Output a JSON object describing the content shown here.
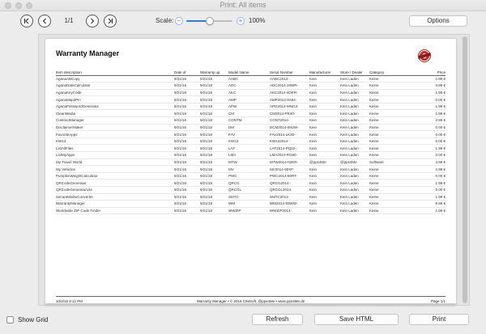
{
  "window": {
    "title": "Print: All items"
  },
  "toolbar": {
    "page_count": "1/1",
    "scale_label": "Scale:",
    "scale_value": "100%",
    "scale_level": 0.5,
    "minus_symbol": "−",
    "plus_symbol": "+",
    "options_label": "Options"
  },
  "document": {
    "title": "Warranty Manager",
    "columns": [
      "Item description",
      "Date of",
      "Warranty up",
      "Model Name",
      "Serial Number",
      "Manufacturer",
      "Store / Dealer",
      "Category",
      "Price"
    ],
    "rows": [
      [
        "AganaABCopy",
        "9/21/16",
        "9/21/18",
        "AABC",
        "AABC2014-",
        "Kein",
        "Kein Laden",
        "Keine",
        "1.99 €"
      ],
      [
        "AganaDateCalculator",
        "9/21/16",
        "9/21/18",
        "ADC",
        "ADC2014-20WR-",
        "Kein",
        "Kein Laden",
        "Keine",
        "0.99 €"
      ],
      [
        "AganaKeyCode",
        "9/21/16",
        "9/21/18",
        "AKC",
        "AKC2014-4OER-",
        "Kein",
        "Kein Laden",
        "Keine",
        "1.99 €"
      ],
      [
        "AganaMap2Pin",
        "9/21/16",
        "9/21/18",
        "AMP",
        "AMP2014-9A84-",
        "Kein",
        "Kein Laden",
        "Keine",
        "0.00 €"
      ],
      [
        "AganaPasswordGenerator",
        "9/21/16",
        "9/21/18",
        "APW",
        "APG2014-MNG3-",
        "Kein",
        "Kein Laden",
        "Keine",
        "1.99 €"
      ],
      [
        "CleanMedia",
        "9/21/16",
        "9/21/18",
        "CM",
        "CM2014-PR40-",
        "Kein",
        "Kein Laden",
        "Keine",
        "1.99 €"
      ],
      [
        "ContractManager",
        "9/21/16",
        "9/21/18",
        "CONTM",
        "CONT2014-",
        "Kein",
        "Kein Laden",
        "Keine",
        "2.99 €"
      ],
      [
        "DisclaimerMaker",
        "9/21/16",
        "9/21/18",
        "DM",
        "DCM2014-09UW-",
        "Kein",
        "Kein Laden",
        "Keine",
        "0.00 €"
      ],
      [
        "FavoriteApps",
        "9/21/16",
        "9/21/18",
        "FAV",
        "FAV2014-LK30-",
        "Kein",
        "Kein Laden",
        "Keine",
        "0.00 €"
      ],
      [
        "KW13",
        "9/21/16",
        "9/21/18",
        "KW13",
        "KW132014-",
        "Kein",
        "Kein Laden",
        "Keine",
        "0.00 €"
      ],
      [
        "ListAllFiles",
        "9/21/16",
        "9/21/18",
        "LAF",
        "LAF2014-PQ02-",
        "Kein",
        "Kein Laden",
        "Keine",
        "1.99 €"
      ],
      [
        "ListMyApps",
        "9/21/16",
        "9/21/18",
        "LMA",
        "LMA2014-RG80-",
        "Kein",
        "Kein Laden",
        "Keine",
        "0.00 €"
      ],
      [
        "My Travel World",
        "9/21/16",
        "9/21/18",
        "MTW",
        "MTW2014-02ER-",
        "@pps4Me",
        "@pps4Me",
        "Software",
        "4.99 €"
      ],
      [
        "My Vehicles",
        "9/21/16",
        "9/21/18",
        "MV",
        "MV2014-90XF-",
        "Kein",
        "Kein Laden",
        "Keine",
        "4.99 €"
      ],
      [
        "PumpkinWeightCalculator",
        "9/21/16",
        "9/21/18",
        "PWC",
        "PWC2014-80RT-",
        "Kein",
        "Kein Laden",
        "Keine",
        "0.00 €"
      ],
      [
        "QRCodeGenerator",
        "9/21/16",
        "9/21/18",
        "QRCG",
        "QRCG2014-",
        "Kein",
        "Kein Laden",
        "Keine",
        "1.99 €"
      ],
      [
        "QRCodeGeneratorLite",
        "9/21/16",
        "9/21/18",
        "QRCGL",
        "QRCGL2014-",
        "Kein",
        "Kein Laden",
        "Keine",
        "0.00 €"
      ],
      [
        "SecureMailtoConverter",
        "9/21/16",
        "9/21/18",
        "SMTC",
        "SMTC2014-",
        "Kein",
        "Kein Laden",
        "Keine",
        "1.99 €"
      ],
      [
        "WarrantyManager",
        "9/21/16",
        "9/21/18",
        "WM",
        "WM2014-93WW-",
        "Kein",
        "Kein Laden",
        "Keine",
        "9.99 €"
      ],
      [
        "Worldwide ZIP Code Finder",
        "9/21/16",
        "9/21/18",
        "WWZIP",
        "WWZIP2014-",
        "Kein",
        "Kein Laden",
        "Keine",
        "1.99 €"
      ]
    ],
    "footer": {
      "date": "10/2/16 9:12 PM",
      "center": "Warranty Manager  •  © 2016 CIMSoft, @pps4Me  •  www.pps4Me.de",
      "page": "Page 1/1"
    }
  },
  "bottom": {
    "show_grid_label": "Show Grid",
    "refresh_label": "Refresh",
    "save_html_label": "Save HTML",
    "print_label": "Print"
  },
  "icons": {
    "first_page": "first-page-icon",
    "prev_page": "previous-page-icon",
    "next_page": "next-page-icon",
    "last_page": "last-page-icon"
  }
}
